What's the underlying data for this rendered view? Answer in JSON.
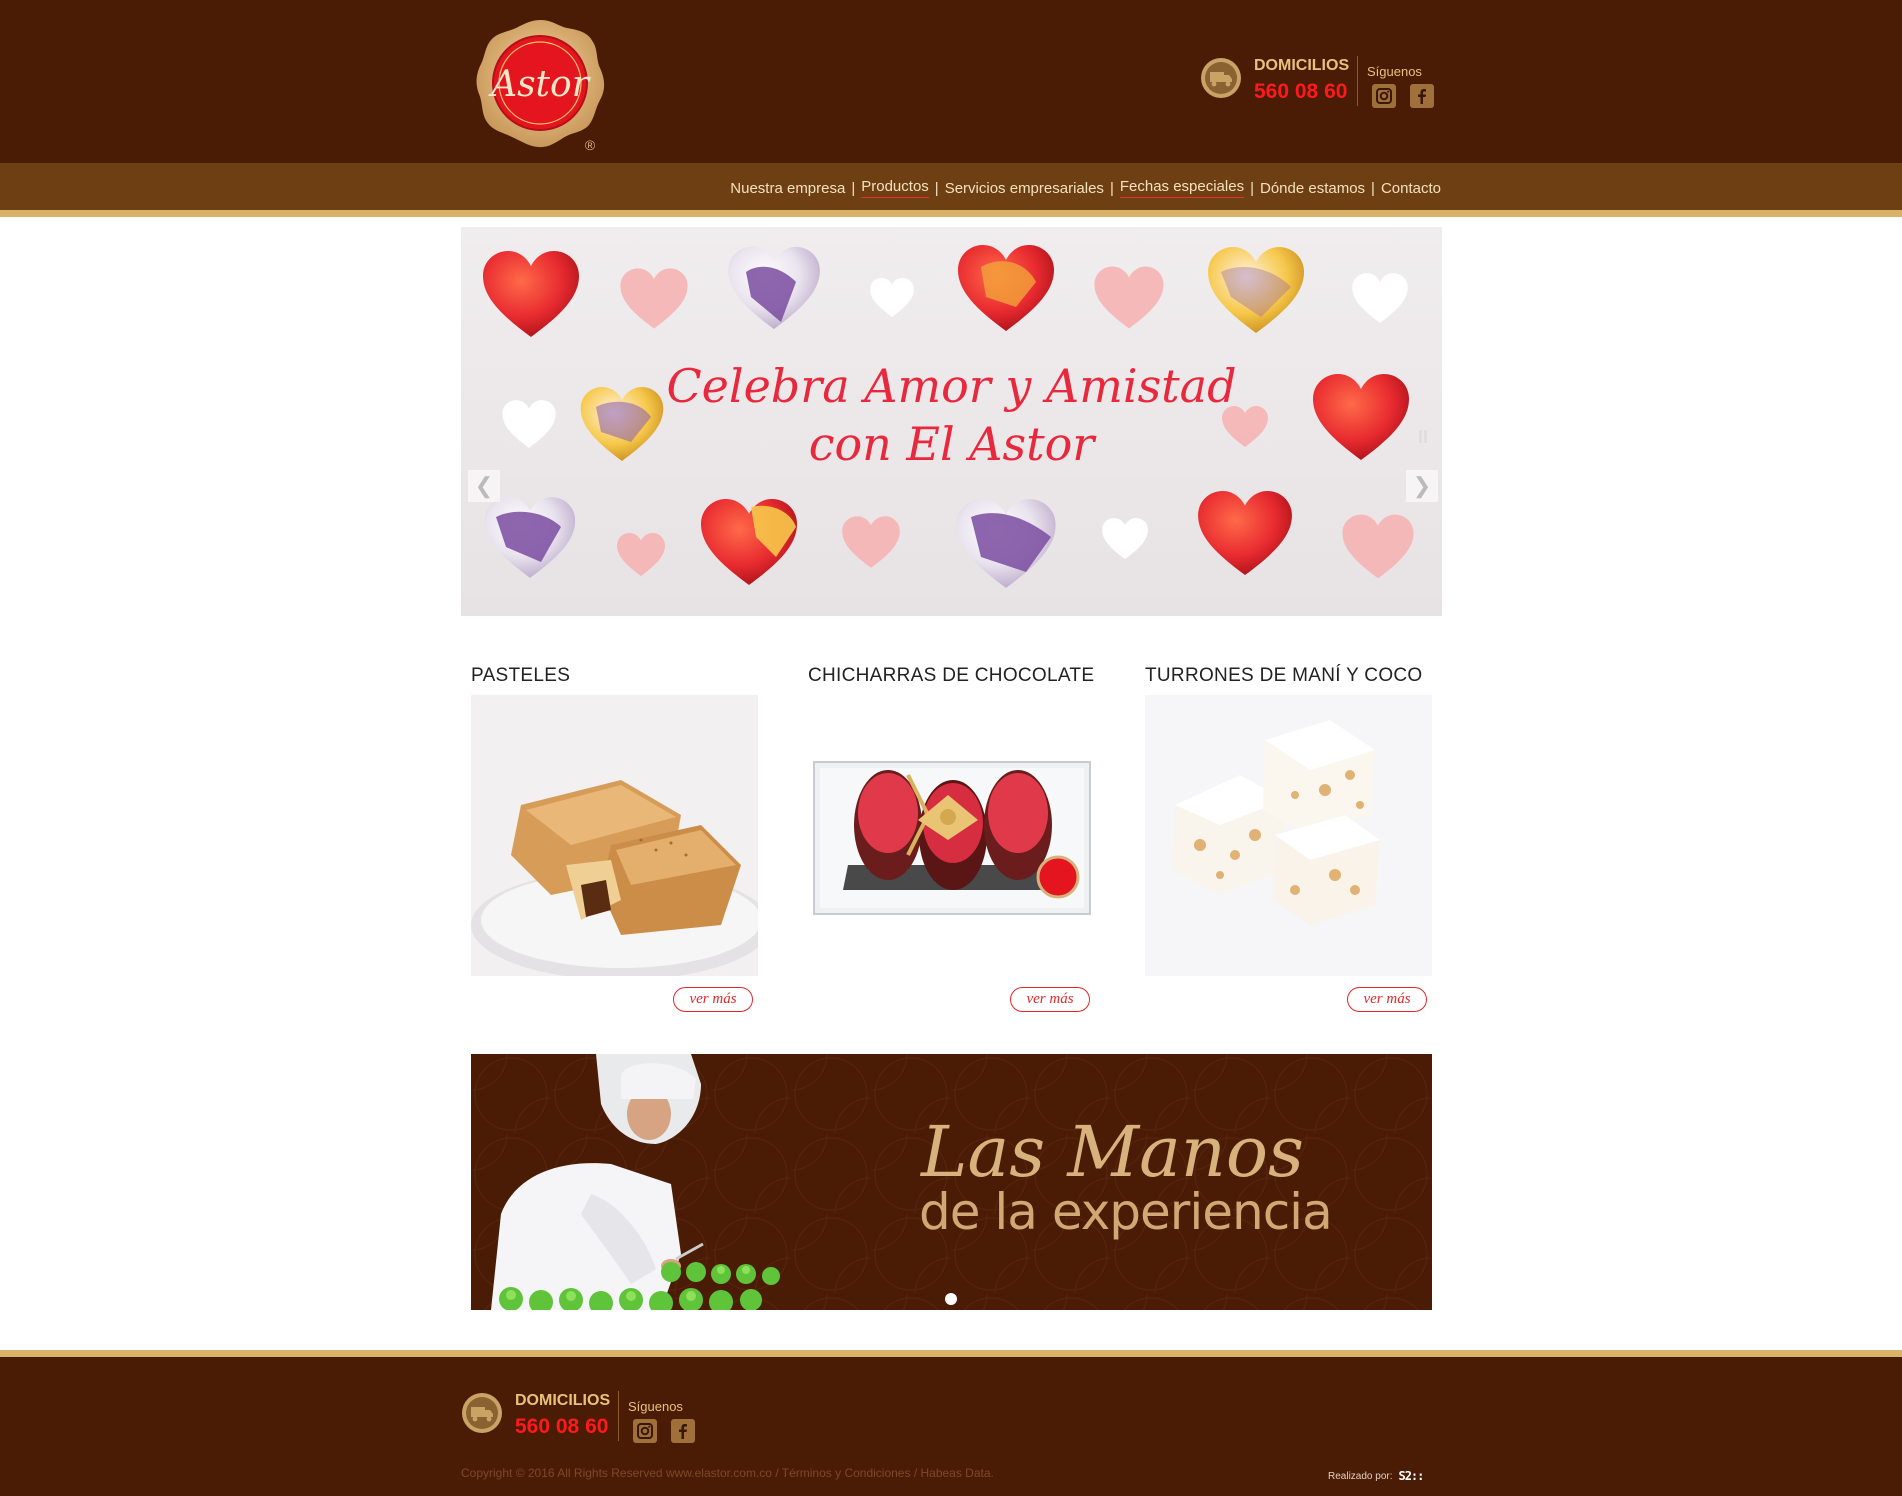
{
  "brand": {
    "logo_text": "Astor",
    "registered": "®"
  },
  "contact": {
    "domicilios_label": "DOMICILIOS",
    "phone": "560 08 60",
    "follow_label": "Síguenos"
  },
  "nav": {
    "items": [
      {
        "label": "Nuestra empresa"
      },
      {
        "label": "Productos"
      },
      {
        "label": "Servicios empresariales"
      },
      {
        "label": "Fechas especiales"
      },
      {
        "label": "Dónde estamos"
      },
      {
        "label": "Contacto"
      }
    ],
    "separator": "|"
  },
  "slider": {
    "line1": "Celebra Amor y Amistad",
    "line2": "con El Astor",
    "prev_icon": "❮",
    "next_icon": "❯",
    "pause_icon": "II"
  },
  "products": [
    {
      "title": "PASTELES",
      "button": "ver más"
    },
    {
      "title": "CHICHARRAS DE CHOCOLATE",
      "button": "ver más"
    },
    {
      "title": "TURRONES DE MANÍ Y COCO",
      "button": "ver más"
    }
  ],
  "banner": {
    "title": "Las Manos",
    "subtitle": "de la experiencia"
  },
  "footer": {
    "copyright": "Copyright © 2016 All Rights Reserved www.elastor.com.co / Términos y Condiciones / Habeas Data.",
    "made_by_label": "Realizado por:",
    "made_by_logo": "S2::"
  },
  "colors": {
    "header_bg": "#4a1c05",
    "nav_bg": "#6e3f12",
    "gold": "#d9b26a",
    "accent_red": "#e02828"
  }
}
